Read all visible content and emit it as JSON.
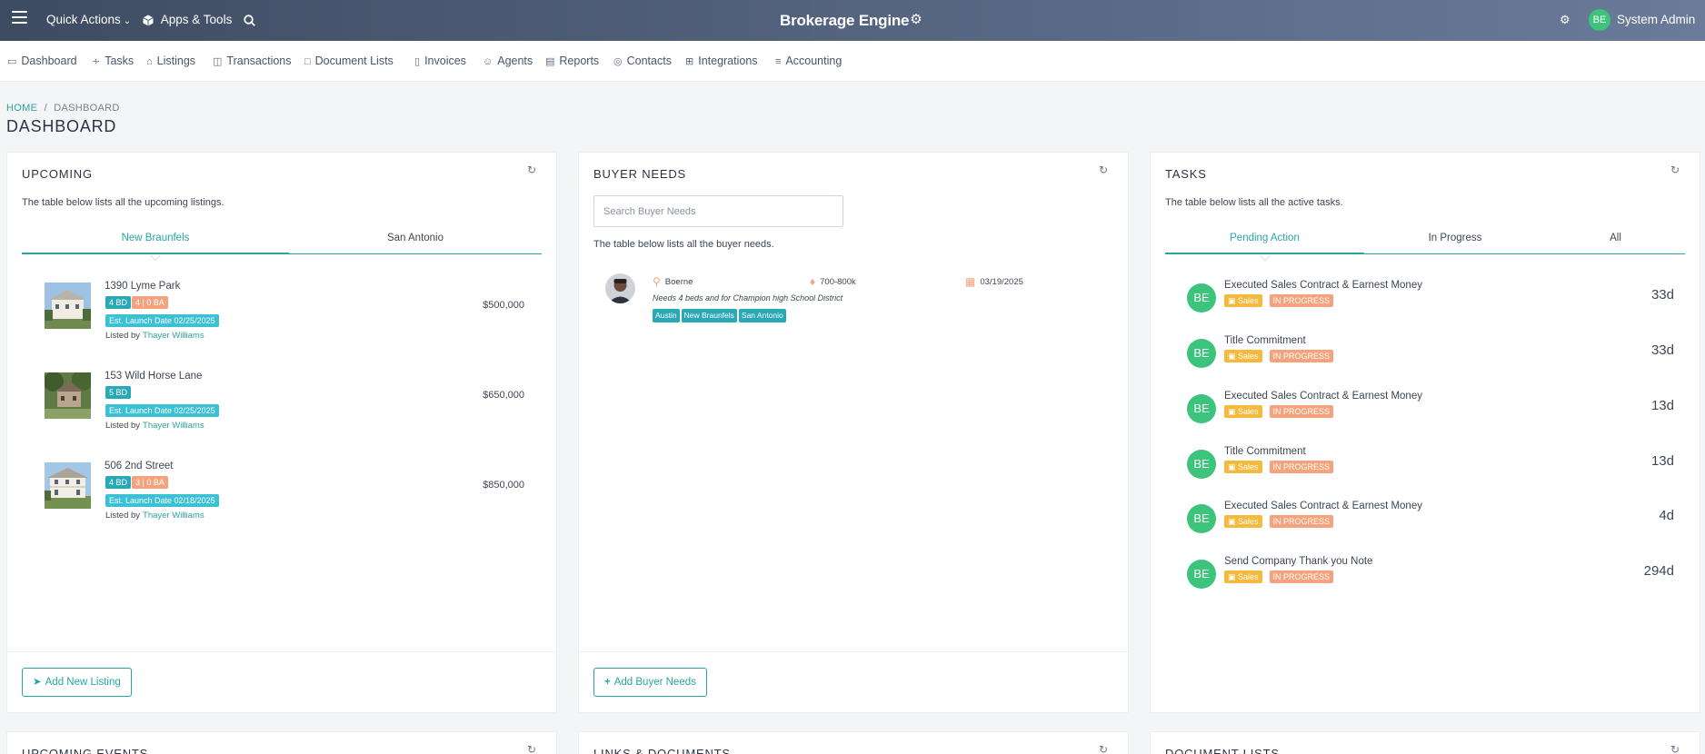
{
  "topbar": {
    "quick_actions": "Quick Actions",
    "apps_tools": "Apps & Tools",
    "brand": "Brokerage Engine",
    "user_initials": "BE",
    "user_name": "System Admin"
  },
  "nav": [
    {
      "label": "Dashboard",
      "icon": "monitor-icon"
    },
    {
      "label": "Tasks",
      "icon": "activity-icon"
    },
    {
      "label": "Listings",
      "icon": "home-icon"
    },
    {
      "label": "Transactions",
      "icon": "building-icon"
    },
    {
      "label": "Document Lists",
      "icon": "folder-icon"
    },
    {
      "label": "Invoices",
      "icon": "file-icon"
    },
    {
      "label": "Agents",
      "icon": "user-icon"
    },
    {
      "label": "Reports",
      "icon": "bar-chart-icon"
    },
    {
      "label": "Contacts",
      "icon": "target-icon"
    },
    {
      "label": "Integrations",
      "icon": "grid-icon"
    },
    {
      "label": "Accounting",
      "icon": "layers-icon"
    }
  ],
  "breadcrumb": {
    "home": "HOME",
    "sep": "/",
    "current": "DASHBOARD"
  },
  "page_title": "DASHBOARD",
  "upcoming": {
    "title": "UPCOMING",
    "description": "The table below lists all the upcoming listings.",
    "tabs": [
      "New Braunfels",
      "San Antonio"
    ],
    "listed_by_label": "Listed by",
    "listings": [
      {
        "address": "1390 Lyme Park",
        "beds": "4 BD",
        "baths": "4 | 0 BA",
        "launch": "Est. Launch Date 02/25/2025",
        "agent": "Thayer Williams",
        "price": "$500,000"
      },
      {
        "address": "153 Wild Horse Lane",
        "beds": "5 BD",
        "baths": "",
        "launch": "Est. Launch Date 02/25/2025",
        "agent": "Thayer Williams",
        "price": "$650,000"
      },
      {
        "address": "506 2nd Street",
        "beds": "4 BD",
        "baths": "3 | 0 BA",
        "launch": "Est. Launch Date 02/18/2025",
        "agent": "Thayer Williams",
        "price": "$850,000"
      }
    ],
    "add_button": "Add New Listing"
  },
  "buyer_needs": {
    "title": "BUYER NEEDS",
    "search_placeholder": "Search Buyer Needs",
    "description": "The table below lists all the buyer needs.",
    "entry": {
      "location": "Boerne",
      "price_range": "700-800k",
      "date": "03/19/2025",
      "note": "Needs 4 beds and for Champion high School District",
      "tags": [
        "Austin",
        "New Braunfels",
        "San Antonio"
      ]
    },
    "add_button": "Add Buyer Needs"
  },
  "tasks": {
    "title": "TASKS",
    "description": "The table below lists all the active tasks.",
    "tabs": [
      "Pending Action",
      "In Progress",
      "All"
    ],
    "sales_label": "Sales",
    "status_label": "IN PROGRESS",
    "avatar_initials": "BE",
    "items": [
      {
        "name": "Executed Sales Contract & Earnest Money",
        "days": "33d"
      },
      {
        "name": "Title Commitment",
        "days": "33d"
      },
      {
        "name": "Executed Sales Contract & Earnest Money",
        "days": "13d"
      },
      {
        "name": "Title Commitment",
        "days": "13d"
      },
      {
        "name": "Executed Sales Contract & Earnest Money",
        "days": "4d"
      },
      {
        "name": "Send Company Thank you Note",
        "days": "294d"
      }
    ]
  },
  "lower_cards": [
    "UPCOMING EVENTS",
    "LINKS & DOCUMENTS",
    "DOCUMENT LISTS"
  ],
  "colors": {
    "accent": "#2aa3a3",
    "badge_teal": "#29a8b5",
    "badge_orange": "#f4a37c",
    "badge_yellow": "#f6b93b",
    "avatar_green": "#3cc47c"
  }
}
